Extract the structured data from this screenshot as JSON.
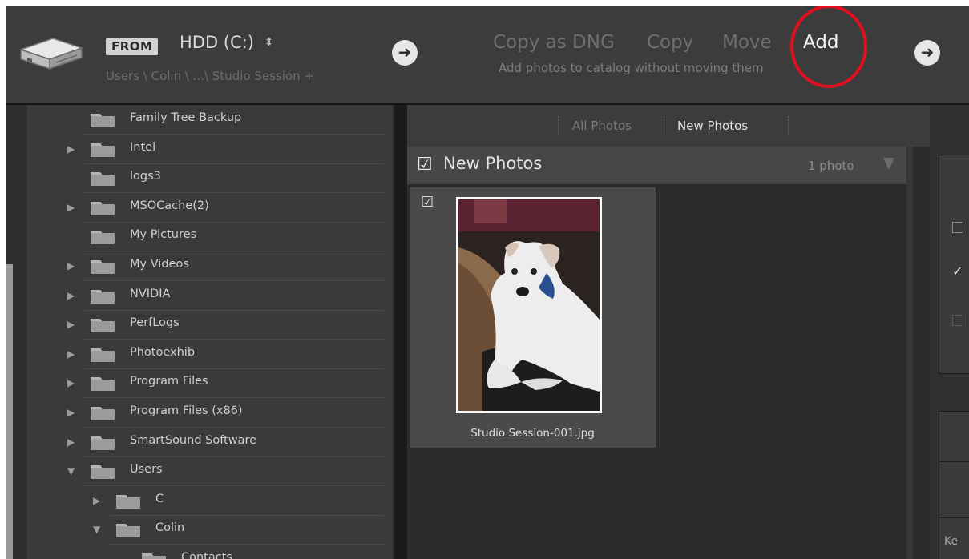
{
  "header": {
    "from_label": "FROM",
    "source_name": "HDD (C:)",
    "source_dropdown_icon": "updown-chevron-icon",
    "source_path": "Users \\ Colin \\ ...\\ Studio Session +",
    "arrow_left_icon": "arrow-right-icon",
    "arrow_right_icon": "arrow-right-icon",
    "modes": [
      "Copy as DNG",
      "Copy",
      "Move",
      "Add"
    ],
    "selected_mode": "Add",
    "mode_description": "Add photos to catalog without moving them",
    "annotation_color": "#e0101e"
  },
  "folders": [
    {
      "label": "Family Tree Backup",
      "expand": "",
      "depth": 0
    },
    {
      "label": "Intel",
      "expand": "▶",
      "depth": 0
    },
    {
      "label": "logs3",
      "expand": "",
      "depth": 0
    },
    {
      "label": "MSOCache(2)",
      "expand": "▶",
      "depth": 0
    },
    {
      "label": "My Pictures",
      "expand": "",
      "depth": 0
    },
    {
      "label": "My Videos",
      "expand": "▶",
      "depth": 0
    },
    {
      "label": "NVIDIA",
      "expand": "▶",
      "depth": 0
    },
    {
      "label": "PerfLogs",
      "expand": "▶",
      "depth": 0
    },
    {
      "label": "Photoexhib",
      "expand": "▶",
      "depth": 0
    },
    {
      "label": "Program Files",
      "expand": "▶",
      "depth": 0
    },
    {
      "label": "Program Files (x86)",
      "expand": "▶",
      "depth": 0
    },
    {
      "label": "SmartSound Software",
      "expand": "▶",
      "depth": 0
    },
    {
      "label": "Users",
      "expand": "▼",
      "depth": 0
    },
    {
      "label": "C",
      "expand": "▶",
      "depth": 1
    },
    {
      "label": "Colin",
      "expand": "▼",
      "depth": 1
    },
    {
      "label": "Contacts",
      "expand": "",
      "depth": 2
    }
  ],
  "view_tabs": {
    "all": "All Photos",
    "new": "New Photos",
    "selected": "New Photos"
  },
  "group": {
    "title": "New Photos",
    "count": "1 photo",
    "checked": true
  },
  "thumbnail": {
    "filename": "Studio Session-001.jpg",
    "checked": true
  },
  "right_panel": {
    "partial_text": "Ke"
  }
}
